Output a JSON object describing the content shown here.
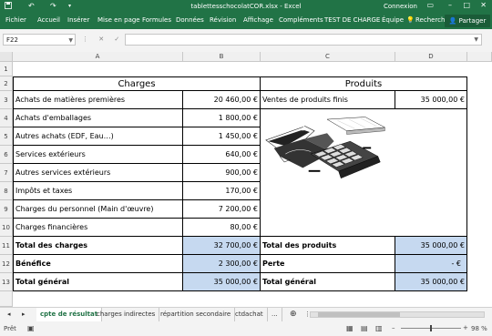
{
  "window": {
    "title": "tablettesschocolatCOR.xlsx  -  Excel",
    "account": "Connexion"
  },
  "ribbon": {
    "tabs": [
      "Fichier",
      "Accueil",
      "Insérer",
      "Mise en page",
      "Formules",
      "Données",
      "Révision",
      "Affichage",
      "Compléments",
      "TEST DE CHARGE",
      "Équipe"
    ],
    "search": "Recherch",
    "share": "Partager"
  },
  "formula_bar": {
    "name_box": "F22",
    "formula": ""
  },
  "columns": [
    "A",
    "B",
    "C",
    "D"
  ],
  "rows": [
    "1",
    "2",
    "3",
    "4",
    "5",
    "6",
    "7",
    "8",
    "9",
    "10",
    "11",
    "12",
    "13"
  ],
  "table": {
    "charges_title": "Charges",
    "produits_title": "Produits",
    "charges": [
      {
        "label": "Achats de matières premières",
        "value": "20 460,00 €"
      },
      {
        "label": "Achats d'emballages",
        "value": "1 800,00 €"
      },
      {
        "label": "Autres achats (EDF, Eau…)",
        "value": "1 450,00 €"
      },
      {
        "label": "Services extérieurs",
        "value": "640,00 €"
      },
      {
        "label": "Autres services extérieurs",
        "value": "900,00 €"
      },
      {
        "label": "Impôts et taxes",
        "value": "170,00 €"
      },
      {
        "label": "Charges du personnel (Main d'œuvre)",
        "value": "7 200,00 €"
      },
      {
        "label": "Charges financières",
        "value": "80,00 €"
      }
    ],
    "produit_line": {
      "label": "Ventes de produits finis",
      "value": "35 000,00 €"
    },
    "total_charges": {
      "label": "Total des charges",
      "value": "32 700,00 €"
    },
    "total_produits": {
      "label": "Total des produits",
      "value": "35 000,00 €"
    },
    "benefice": {
      "label": "Bénéfice",
      "value": "2 300,00 €"
    },
    "perte": {
      "label": "Perte",
      "value": "-   €"
    },
    "total_general_left": {
      "label": "Total général",
      "value": "35 000,00 €"
    },
    "total_general_right": {
      "label": "Total général",
      "value": "35 000,00 €"
    }
  },
  "sheets": {
    "tabs": [
      "cpte de résultat",
      "charges indirectes",
      "répartition secondaire",
      "ctdachat"
    ],
    "active": 0,
    "more": "..."
  },
  "status": {
    "left": "Prêt",
    "zoom": "98 %"
  }
}
